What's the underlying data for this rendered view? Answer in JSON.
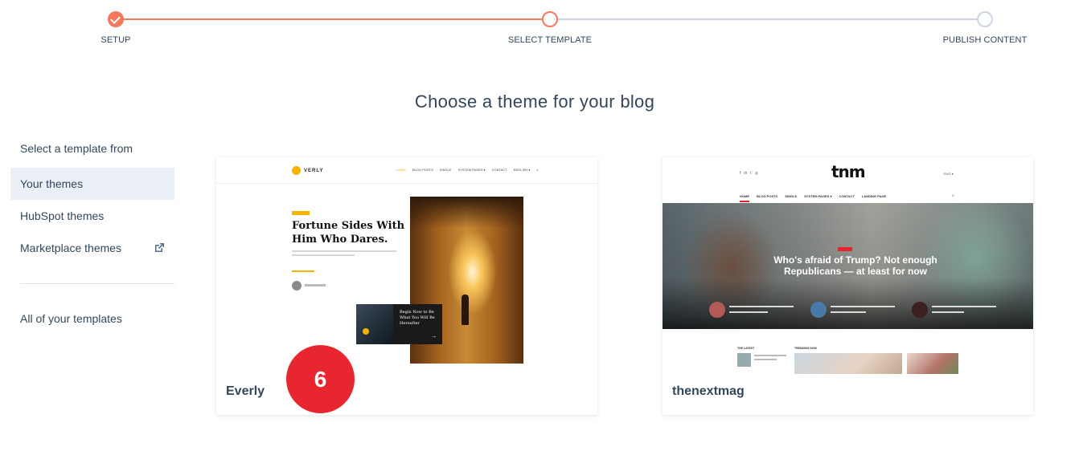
{
  "stepper": {
    "steps": [
      {
        "label": "SETUP",
        "status": "complete"
      },
      {
        "label": "SELECT TEMPLATE",
        "status": "current"
      },
      {
        "label": "PUBLISH CONTENT",
        "status": "upcoming"
      }
    ],
    "accent_color": "#f2795c",
    "inactive_color": "#cbd6e2"
  },
  "page_title": "Choose a theme for your blog",
  "sidebar": {
    "heading": "Select a template from",
    "items": [
      {
        "label": "Your themes",
        "active": true
      },
      {
        "label": "HubSpot themes",
        "active": false
      },
      {
        "label": "Marketplace themes",
        "active": false,
        "icon": "external-link-icon"
      }
    ],
    "footer_link": "All of your templates"
  },
  "themes": [
    {
      "name": "Everly",
      "preview": {
        "logo": "VERLY",
        "menu": [
          "HOME",
          "BLOG POSTS",
          "SINGLE",
          "SYSTEM PAGES ▾",
          "CONTACT",
          "ENGLISH ▾"
        ],
        "headline": "Fortune Sides With Him Who Dares.",
        "overlay_title": "Begin Now to Be What You Will Be Hereafter",
        "accent": "#f5b400"
      }
    },
    {
      "name": "thenextmag",
      "preview": {
        "logo": "tnm",
        "social": [
          "f",
          "in",
          "t",
          "◎"
        ],
        "lang": "ENG ▾",
        "menu": [
          "HOME",
          "BLOG POSTS",
          "SINGLE",
          "SYSTEM PAGES ▾",
          "CONTACT",
          "LANDING PAGE"
        ],
        "headline": "Who's afraid of Trump? Not enough Republicans — at least for now",
        "section_latest": "THE LATEST",
        "section_trending": "TRENDING NOW",
        "accent": "#e8242c"
      }
    }
  ],
  "badge": {
    "value": "6",
    "color": "#e8262f"
  }
}
